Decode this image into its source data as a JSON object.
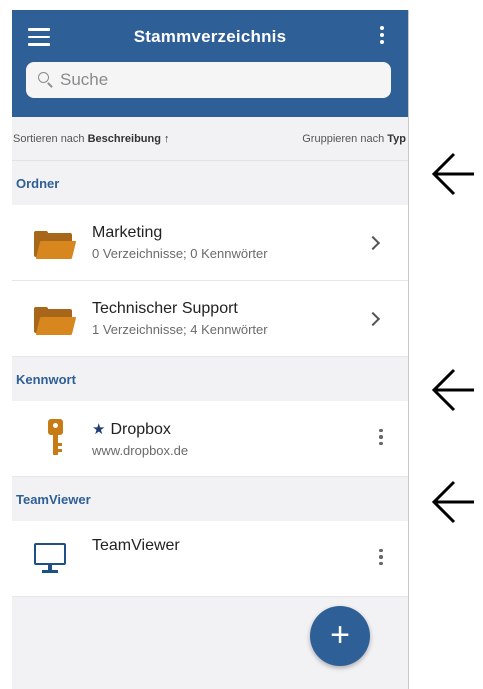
{
  "header": {
    "title": "Stammverzeichnis",
    "menu_icon": "hamburger-menu-icon",
    "overflow_icon": "vertical-dots-icon"
  },
  "search": {
    "placeholder": "Suche",
    "value": ""
  },
  "sort_bar": {
    "sort_prefix": "Sortieren nach ",
    "sort_field": "Beschreibung ↑",
    "group_prefix": "Gruppieren nach ",
    "group_field": "Typ"
  },
  "sections": [
    {
      "title": "Ordner",
      "items": [
        {
          "title": "Marketing",
          "subtitle": "0 Verzeichnisse; 0 Kennwörter",
          "icon": "folder-icon"
        },
        {
          "title": "Technischer Support",
          "subtitle": "1 Verzeichnisse; 4 Kennwörter",
          "icon": "folder-icon"
        }
      ]
    },
    {
      "title": "Kennwort",
      "items": [
        {
          "star": "★",
          "title": "Dropbox",
          "subtitle": "www.dropbox.de",
          "icon": "key-icon"
        }
      ]
    },
    {
      "title": "TeamViewer",
      "items": [
        {
          "title": "TeamViewer",
          "subtitle": "",
          "icon": "monitor-icon"
        }
      ]
    }
  ],
  "fab": {
    "label": "+"
  },
  "colors": {
    "primary": "#2e5f96",
    "folder": "#d8861e",
    "key": "#c77b14",
    "background": "#f2f2f4"
  }
}
